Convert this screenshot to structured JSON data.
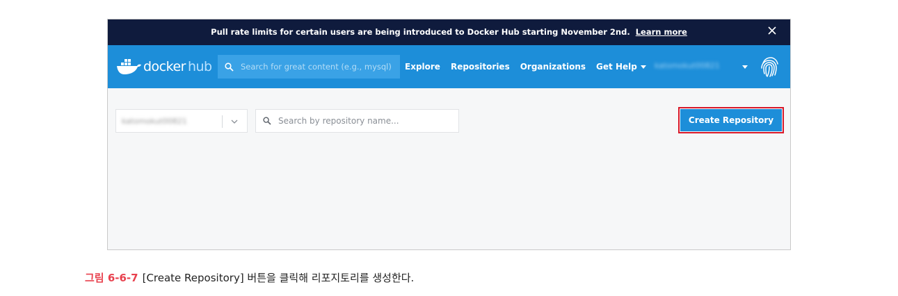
{
  "banner": {
    "message": "Pull rate limits for certain users are being introduced to Docker Hub starting November 2nd.",
    "link_label": "Learn more",
    "close_icon": "close-icon"
  },
  "navbar": {
    "logo_text": "docker",
    "logo_hub": "hub",
    "search_placeholder": "Search for great content (e.g., mysql)",
    "links": [
      "Explore",
      "Repositories",
      "Organizations",
      "Get Help"
    ],
    "username": "katomokut00821"
  },
  "toolbar": {
    "org_selected": "katomokut00821",
    "repo_search_placeholder": "Search by repository name...",
    "create_button_label": "Create Repository"
  },
  "caption": {
    "label": "그림 6-6-7",
    "text": "[Create Repository] 버튼을 클릭해 리포지토리를 생성한다."
  },
  "colors": {
    "banner_bg": "#0f1b3d",
    "navbar_bg": "#1d8ed9",
    "highlight": "#d8192a",
    "caption_label": "#e8414e"
  }
}
